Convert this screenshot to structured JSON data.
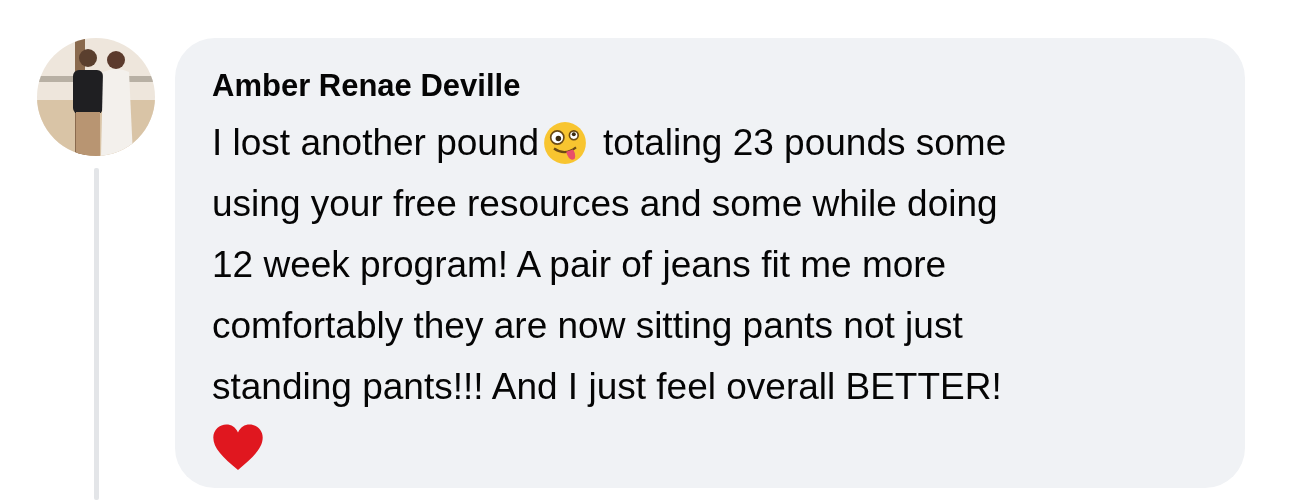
{
  "comment": {
    "author": "Amber Renae Deville",
    "lines": [
      [
        {
          "kind": "text",
          "text": "I lost another pound"
        },
        {
          "kind": "emoji-face"
        },
        {
          "kind": "text",
          "text": "totaling 23 pounds some"
        }
      ],
      [
        {
          "kind": "text",
          "text": "using your free resources and some while doing"
        }
      ],
      [
        {
          "kind": "text",
          "text": "12 week program! A pair of jeans fit me more"
        }
      ],
      [
        {
          "kind": "text",
          "text": "comfortably they are now sitting pants not just"
        }
      ],
      [
        {
          "kind": "text",
          "text": "standing pants!!! And I just feel overall BETTER!"
        }
      ],
      [
        {
          "kind": "emoji-heart"
        }
      ]
    ]
  }
}
